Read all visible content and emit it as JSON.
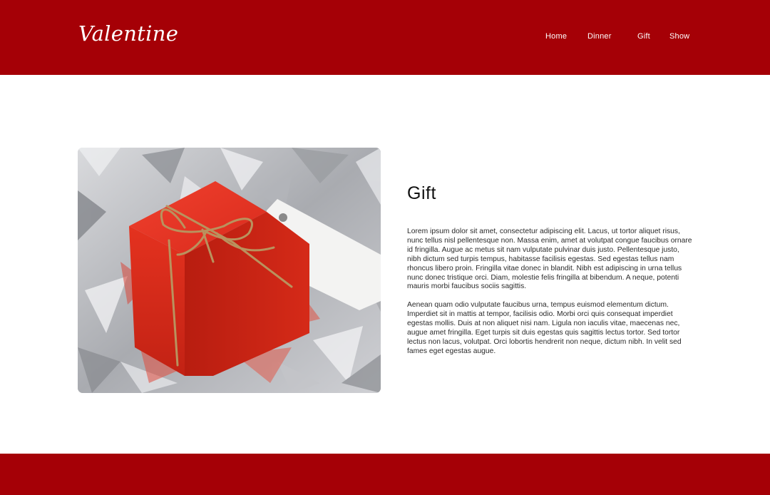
{
  "brand": {
    "logo": "Valentine"
  },
  "nav": [
    {
      "label": "Home"
    },
    {
      "label": "Dinner"
    },
    {
      "label": "Gift"
    },
    {
      "label": "Show"
    }
  ],
  "section": {
    "title": "Gift",
    "paragraphs": [
      "Lorem ipsum dolor sit amet, consectetur adipiscing elit. Lacus, ut tortor aliquet risus, nunc tellus nisl pellentesque non. Massa enim, amet at volutpat congue faucibus ornare id fringilla. Augue ac metus sit nam vulputate pulvinar duis justo. Pellentesque justo, nibh dictum sed turpis tempus, habitasse facilisis egestas. Sed egestas tellus nam rhoncus libero proin. Fringilla vitae donec in blandit. Nibh est adipiscing in urna tellus nunc donec tristique orci. Diam, molestie felis fringilla at bibendum. A neque, potenti mauris morbi faucibus sociis sagittis.",
      "Aenean quam odio vulputate faucibus urna, tempus euismod elementum dictum. Imperdiet sit in mattis at tempor, facilisis odio. Morbi orci quis consequat imperdiet egestas mollis. Duis at non aliquet nisi nam. Ligula non iaculis vitae, maecenas nec, augue amet fringilla. Eget turpis sit duis egestas quis sagittis lectus tortor. Sed tortor lectus non lacus, volutpat. Orci lobortis hendrerit non neque, dictum nibh. In velit sed fames eget egestas augue."
    ]
  },
  "colors": {
    "brand_red": "#a50006",
    "background": "#ffffff",
    "text": "#1a1a1a"
  }
}
